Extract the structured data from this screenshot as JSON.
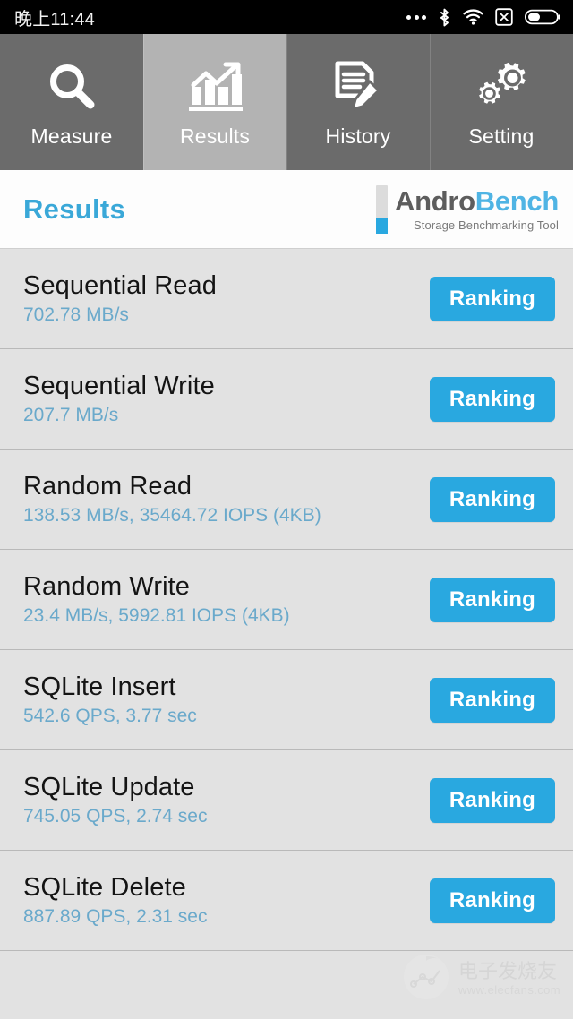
{
  "statusbar": {
    "clock": "晚上11:44",
    "icons": [
      "more-dots-icon",
      "bluetooth-icon",
      "wifi-icon",
      "no-sim-icon",
      "battery-icon"
    ]
  },
  "tabs": [
    {
      "label": "Measure",
      "icon": "magnifier-icon",
      "active": false
    },
    {
      "label": "Results",
      "icon": "bar-chart-icon",
      "active": true
    },
    {
      "label": "History",
      "icon": "document-pencil-icon",
      "active": false
    },
    {
      "label": "Setting",
      "icon": "gears-icon",
      "active": false
    }
  ],
  "header": {
    "title": "Results",
    "brand_part1": "Andro",
    "brand_part2": "Bench",
    "brand_subtitle": "Storage Benchmarking Tool"
  },
  "results": {
    "button_label": "Ranking",
    "rows": [
      {
        "title": "Sequential Read",
        "value": "702.78 MB/s"
      },
      {
        "title": "Sequential Write",
        "value": "207.7 MB/s"
      },
      {
        "title": "Random Read",
        "value": "138.53 MB/s, 35464.72 IOPS (4KB)"
      },
      {
        "title": "Random Write",
        "value": "23.4 MB/s, 5992.81 IOPS (4KB)"
      },
      {
        "title": "SQLite Insert",
        "value": "542.6 QPS, 3.77 sec"
      },
      {
        "title": "SQLite Update",
        "value": "745.05 QPS, 2.74 sec"
      },
      {
        "title": "SQLite Delete",
        "value": "887.89 QPS, 2.31 sec"
      }
    ]
  },
  "watermark": {
    "cn": "电子发烧友",
    "url": "www.elecfans.com"
  },
  "colors": {
    "accent_blue": "#29a8e0",
    "title_blue": "#3aa8d8",
    "value_blue": "#6aa9cb",
    "tab_inactive": "#6b6b6b",
    "tab_active": "#b3b3b3",
    "list_bg": "#e2e2e2"
  }
}
